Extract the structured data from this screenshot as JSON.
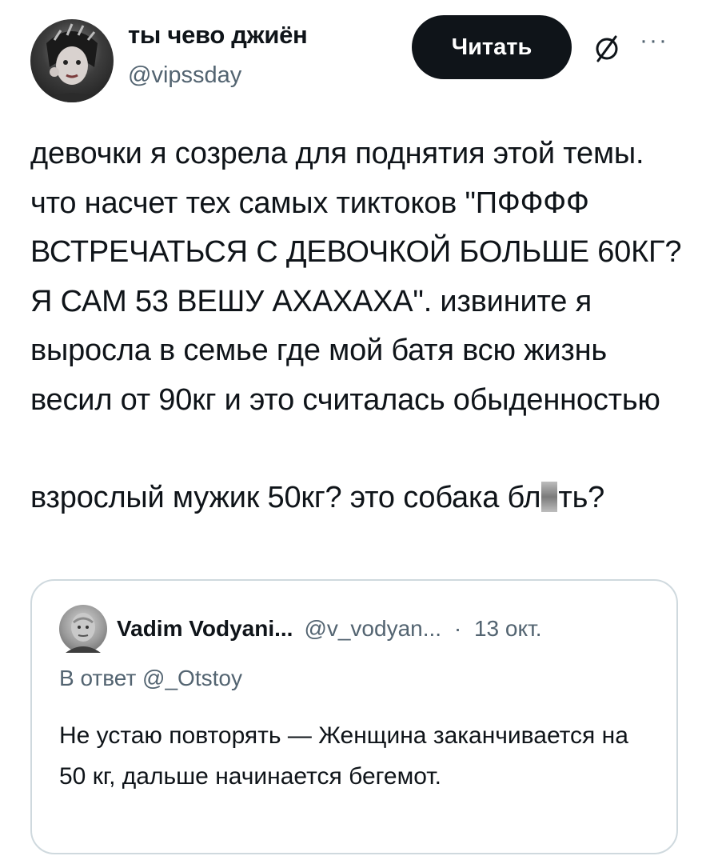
{
  "author": {
    "name": "ты чево джиён",
    "handle": "@vipssday"
  },
  "header": {
    "follow_label": "Читать",
    "grok_icon": "slash-circle-icon",
    "more_label": "···"
  },
  "tweet": {
    "paragraph1": "девочки я созрела для поднятия этой темы. что насчет тех самых тиктоков \"ПФФФФ ВСТРЕЧАТЬСЯ С ДЕВОЧКОЙ БОЛЬШЕ 60КГ? Я САМ 53 ВЕШУ АХАХАХА\". извините я выросла в семье где мой батя всю жизнь весил от 90кг и это считалась обыденностью",
    "paragraph2_before": "взрослый мужик 50кг? это собака бл",
    "paragraph2_after": "ть?"
  },
  "quote": {
    "name": "Vadim Vodyani...",
    "handle": "@v_vodyan...",
    "separator": "·",
    "date": "13 окт.",
    "reply_to": "В ответ @_Otstoy",
    "text": "Не устаю повторять — Женщина заканчивается на 50 кг, дальше начинается бегемот."
  }
}
